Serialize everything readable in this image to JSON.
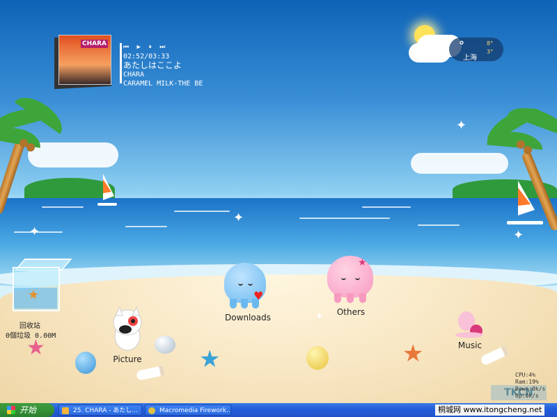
{
  "music_player": {
    "controls": "⏮ ▶ ⏸ ⏭",
    "time": "02:52/03:33",
    "song": "あたしはここよ",
    "artist": "CHARA",
    "album": "CARAMEL MILK-THE BE",
    "album_art_text": "CHARA"
  },
  "weather": {
    "degree_symbol": "°",
    "city": "上海",
    "temp_high": "8°",
    "temp_low": "3°"
  },
  "desktop_icons": [
    {
      "label": "Downloads"
    },
    {
      "label": "Others"
    },
    {
      "label": "Picture"
    },
    {
      "label": "Music"
    }
  ],
  "recycle_bin": {
    "label": "回收站",
    "info": "0個垃圾 0.00M"
  },
  "system_monitor": {
    "cpu": "CPU:4%",
    "ram": "Ram:19%",
    "down": "Down:0k/s",
    "up": "Up:0k/s"
  },
  "watermark": "TKCN",
  "taskbar": {
    "start_label": "开始",
    "tasks": [
      {
        "label": "25. CHARA - あたし..."
      },
      {
        "label": "Macromedia Firework..."
      }
    ],
    "tray_text": "桐城网 www.itongcheng.net"
  },
  "colors": {
    "sky": "#0f63b7",
    "sea": "#1c73c8",
    "sand": "#f7e5c0",
    "taskbar": "#245edb",
    "start": "#359136"
  }
}
